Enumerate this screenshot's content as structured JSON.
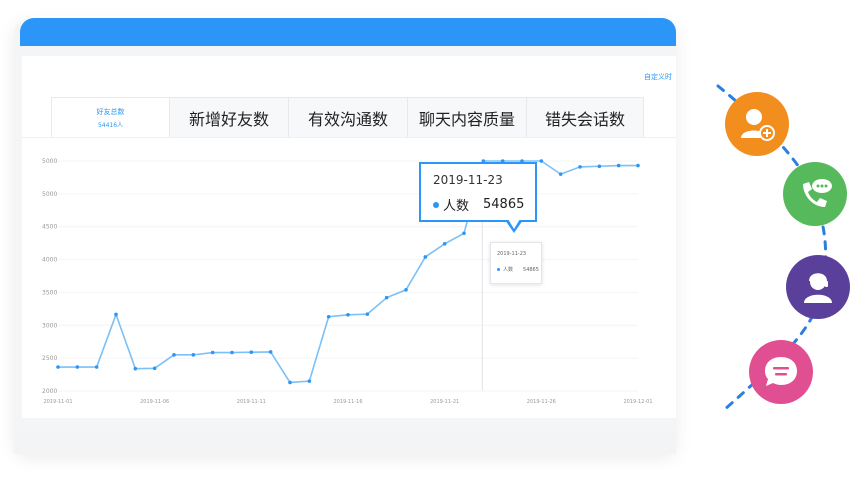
{
  "panel": {
    "corner_link": "自定义时"
  },
  "tabs": [
    {
      "label": "好友总数",
      "sub": "54416人",
      "active": true
    },
    {
      "label": "新增好友数",
      "active": false
    },
    {
      "label": "有效沟通数",
      "active": false
    },
    {
      "label": "聊天内容质量",
      "active": false
    },
    {
      "label": "错失会话数",
      "active": false
    }
  ],
  "tooltip": {
    "date": "2019-11-23",
    "series": "人数",
    "value": "54865"
  },
  "tooltip_small": {
    "date": "2019-11-23",
    "series": "人数",
    "value": "54865"
  },
  "chart_data": {
    "type": "line",
    "yticks": [
      "5000",
      "5000",
      "4500",
      "4000",
      "3500",
      "3000",
      "2500",
      "2000"
    ],
    "xticks": [
      "2019-11-01",
      "2019-11-06",
      "2019-11-11",
      "2019-11-16",
      "2019-11-21",
      "2019-11-26",
      "2019-12-01"
    ],
    "series": [
      {
        "values": [
          2365,
          2365,
          2365,
          3165,
          2340,
          2345,
          2550,
          2550,
          2585,
          2585,
          2590,
          2595,
          2130,
          2150,
          3130,
          3160,
          3170,
          3420,
          3540,
          4040,
          4240,
          4400,
          5500,
          5500,
          5500,
          5500,
          5300,
          5410,
          5420,
          5430,
          5430
        ]
      }
    ],
    "colors": {
      "line": "#7cc0f5",
      "point": "#2b96f7"
    }
  },
  "side_icons": [
    {
      "name": "add-user-icon",
      "color": "#f28e1e"
    },
    {
      "name": "phone-chat-icon",
      "color": "#56b95b"
    },
    {
      "name": "customer-service-icon",
      "color": "#5a3f9b"
    },
    {
      "name": "message-icon",
      "color": "#e04f92"
    }
  ]
}
